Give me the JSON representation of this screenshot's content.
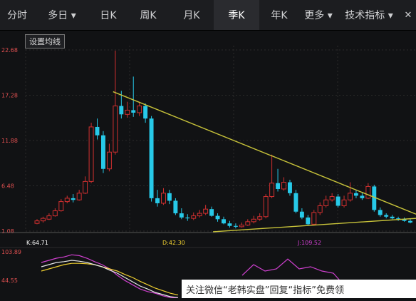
{
  "tabs": [
    {
      "label": "分时",
      "active": false
    },
    {
      "label": "多日 ▾",
      "active": false
    },
    {
      "label": "日K",
      "active": false
    },
    {
      "label": "周K",
      "active": false
    },
    {
      "label": "月K",
      "active": false
    },
    {
      "label": "季K",
      "active": true
    },
    {
      "label": "年K",
      "active": false
    },
    {
      "label": "更多 ▾",
      "active": false
    },
    {
      "label": "技术指标 ▾",
      "active": false
    }
  ],
  "close_label": "✕",
  "ma_button_label": "设置均线",
  "indicators": {
    "k": "K:64.71",
    "d": "D:42.30",
    "j": "J:109.52"
  },
  "kdj_axis": {
    "top": "103.89",
    "mid": "44.55"
  },
  "watermark": "关注微信“老韩实盘”回复“指标”免费领",
  "colors": {
    "up": "#d23030",
    "down": "#27c9e8",
    "trend": "#c9c43a",
    "k": "#e8e8e8",
    "d": "#f0d030",
    "j": "#d040d0"
  },
  "chart_data": {
    "type": "candlestick",
    "y_ticks": [
      "22.68",
      "17.28",
      "11.88",
      "6.48",
      "1.08"
    ],
    "ylim": [
      1.08,
      22.68
    ],
    "candles": [
      [
        2.0,
        2.3,
        1.9,
        2.5
      ],
      [
        2.3,
        2.6,
        2.1,
        2.8
      ],
      [
        2.5,
        2.9,
        2.4,
        3.2
      ],
      [
        2.9,
        3.5,
        2.8,
        3.8
      ],
      [
        3.5,
        4.6,
        3.4,
        4.9
      ],
      [
        4.6,
        5.0,
        4.4,
        5.3
      ],
      [
        5.0,
        4.8,
        4.5,
        5.5
      ],
      [
        4.8,
        5.6,
        4.7,
        6.0
      ],
      [
        5.6,
        7.0,
        5.5,
        7.6
      ],
      [
        7.0,
        13.5,
        6.8,
        14.0
      ],
      [
        13.5,
        12.5,
        12.0,
        14.5
      ],
      [
        12.5,
        8.5,
        8.0,
        13.0
      ],
      [
        8.5,
        10.5,
        8.2,
        11.5
      ],
      [
        10.5,
        16.0,
        10.2,
        22.6
      ],
      [
        16.0,
        15.0,
        14.5,
        17.8
      ],
      [
        15.0,
        15.5,
        14.6,
        16.5
      ],
      [
        15.5,
        15.2,
        14.7,
        19.5
      ],
      [
        15.2,
        16.0,
        14.8,
        16.5
      ],
      [
        16.0,
        14.5,
        14.0,
        16.3
      ],
      [
        14.5,
        5.0,
        4.6,
        14.8
      ],
      [
        5.0,
        4.4,
        4.0,
        6.0
      ],
      [
        4.4,
        5.6,
        4.2,
        6.2
      ],
      [
        5.6,
        4.7,
        4.3,
        6.0
      ],
      [
        4.7,
        3.2,
        3.0,
        5.0
      ],
      [
        3.2,
        2.7,
        2.5,
        3.8
      ],
      [
        2.7,
        2.6,
        2.3,
        3.1
      ],
      [
        2.6,
        2.9,
        2.4,
        3.3
      ],
      [
        2.9,
        3.2,
        2.7,
        3.6
      ],
      [
        3.2,
        3.7,
        3.0,
        4.2
      ],
      [
        3.7,
        2.9,
        2.8,
        4.0
      ],
      [
        2.9,
        2.5,
        2.2,
        3.2
      ],
      [
        2.5,
        2.0,
        1.9,
        2.8
      ],
      [
        2.0,
        1.7,
        1.5,
        2.3
      ],
      [
        1.7,
        1.6,
        1.4,
        2.0
      ],
      [
        1.6,
        1.8,
        1.5,
        2.1
      ],
      [
        1.8,
        2.2,
        1.7,
        2.5
      ],
      [
        2.2,
        2.5,
        2.0,
        2.9
      ],
      [
        2.5,
        2.8,
        2.3,
        3.2
      ],
      [
        2.8,
        5.2,
        2.6,
        5.5
      ],
      [
        5.2,
        6.8,
        5.0,
        10.2
      ],
      [
        6.8,
        6.1,
        5.8,
        8.5
      ],
      [
        6.1,
        6.9,
        5.9,
        7.5
      ],
      [
        6.9,
        5.6,
        5.3,
        7.2
      ],
      [
        5.6,
        3.4,
        3.2,
        6.0
      ],
      [
        3.4,
        2.7,
        2.5,
        3.8
      ],
      [
        2.7,
        1.9,
        1.8,
        3.0
      ],
      [
        1.9,
        3.3,
        1.8,
        3.6
      ],
      [
        3.3,
        4.1,
        3.0,
        4.5
      ],
      [
        4.1,
        4.8,
        3.9,
        5.3
      ],
      [
        4.8,
        5.2,
        4.6,
        5.6
      ],
      [
        5.2,
        4.1,
        3.9,
        5.5
      ],
      [
        4.1,
        4.8,
        3.9,
        5.3
      ],
      [
        4.8,
        5.6,
        4.6,
        6.9
      ],
      [
        5.6,
        5.3,
        5.0,
        6.0
      ],
      [
        5.3,
        5.0,
        4.8,
        5.7
      ],
      [
        5.0,
        6.4,
        4.9,
        6.8
      ],
      [
        6.4,
        3.6,
        3.4,
        6.6
      ],
      [
        3.6,
        3.0,
        2.8,
        3.9
      ],
      [
        3.0,
        2.8,
        2.6,
        3.2
      ],
      [
        2.8,
        2.6,
        2.5,
        3.0
      ],
      [
        2.6,
        2.5,
        2.3,
        2.8
      ],
      [
        2.5,
        2.3,
        2.2,
        2.7
      ],
      [
        2.3,
        2.1,
        2.0,
        2.5
      ]
    ],
    "trendlines": [
      [
        [
          0.224,
          17.7
        ],
        [
          1.0,
          3.1
        ]
      ],
      [
        [
          0.48,
          1.0
        ],
        [
          1.0,
          2.6
        ]
      ]
    ],
    "kdj": {
      "ylim": [
        0,
        120
      ],
      "k": [
        80,
        85,
        90,
        92,
        95,
        93,
        90,
        85,
        80,
        72,
        65,
        55,
        45,
        35,
        28,
        20,
        15,
        10,
        8
      ],
      "d": [
        70,
        75,
        80,
        85,
        88,
        88,
        87,
        85,
        80,
        75,
        70,
        62,
        55,
        46,
        38,
        30,
        24,
        18,
        14
      ],
      "j": [
        90,
        95,
        100,
        103,
        108,
        106,
        100,
        92,
        85,
        75,
        60,
        48,
        38,
        28,
        22,
        18,
        12,
        8,
        6
      ],
      "j2": [
        60,
        85,
        70,
        75,
        98,
        75,
        80,
        70,
        65,
        35,
        40
      ]
    }
  }
}
